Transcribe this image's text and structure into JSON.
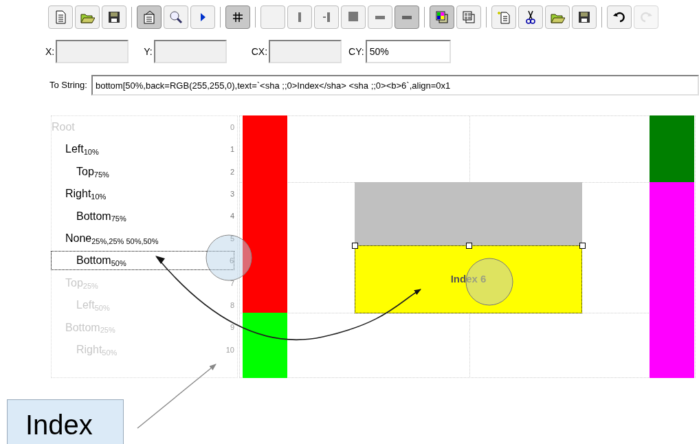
{
  "toolbar": [
    {
      "kind": "new",
      "selected": false,
      "disabled": false
    },
    {
      "kind": "open",
      "selected": false,
      "disabled": false
    },
    {
      "kind": "save",
      "selected": false,
      "disabled": false
    },
    {
      "kind": "sep"
    },
    {
      "kind": "properties",
      "selected": true,
      "disabled": false
    },
    {
      "kind": "zoom",
      "selected": false,
      "disabled": false
    },
    {
      "kind": "play",
      "selected": false,
      "disabled": false
    },
    {
      "kind": "sep"
    },
    {
      "kind": "grid",
      "selected": true,
      "disabled": false
    },
    {
      "kind": "sep"
    },
    {
      "kind": "blank",
      "selected": false,
      "disabled": false
    },
    {
      "kind": "lines1",
      "selected": false,
      "disabled": false
    },
    {
      "kind": "lines2",
      "selected": false,
      "disabled": false
    },
    {
      "kind": "lines3",
      "selected": false,
      "disabled": false
    },
    {
      "kind": "ticktop",
      "selected": false,
      "disabled": false
    },
    {
      "kind": "tickbottom",
      "selected": true,
      "disabled": false
    },
    {
      "kind": "sep"
    },
    {
      "kind": "colors",
      "selected": true,
      "disabled": false
    },
    {
      "kind": "panes",
      "selected": false,
      "disabled": false
    },
    {
      "kind": "sep"
    },
    {
      "kind": "newdoc",
      "selected": false,
      "disabled": false
    },
    {
      "kind": "cut",
      "selected": false,
      "disabled": false
    },
    {
      "kind": "open",
      "selected": false,
      "disabled": false
    },
    {
      "kind": "save",
      "selected": false,
      "disabled": false
    },
    {
      "kind": "sep"
    },
    {
      "kind": "undo",
      "selected": false,
      "disabled": false
    },
    {
      "kind": "redo",
      "selected": false,
      "disabled": true
    }
  ],
  "coords": [
    {
      "label": "X:"
    },
    {
      "label": "Y:"
    },
    {
      "label": "CX:"
    },
    {
      "label": "CY:",
      "value": "50%"
    }
  ],
  "to_string": {
    "label": "To String:",
    "value": "bottom[50%,back=RGB(255,255,0),text=`<sha ;;0>Index</sha> <sha ;;0><b>6`,align=0x1"
  },
  "tree": {
    "items": [
      {
        "label": "Root",
        "index": "0",
        "disabled": true,
        "selected": false,
        "children": [
          {
            "label": "Left",
            "size": "10%",
            "index": "1",
            "disabled": false,
            "selected": false,
            "children": [
              {
                "label": "Top",
                "size": "75%",
                "index": "2",
                "disabled": false,
                "selected": false
              }
            ]
          },
          {
            "label": "Right",
            "size": "10%",
            "index": "3",
            "disabled": false,
            "selected": false,
            "children": [
              {
                "label": "Bottom",
                "size": "75%",
                "index": "4",
                "disabled": false,
                "selected": false
              }
            ]
          },
          {
            "label": "None",
            "size": "25%,25% 50%,50%",
            "index": "5",
            "disabled": false,
            "selected": false,
            "children": [
              {
                "label": "Bottom",
                "size": "50%",
                "index": "6",
                "disabled": false,
                "selected": true
              }
            ]
          },
          {
            "label": "Top",
            "size": "25%",
            "index": "7",
            "disabled": true,
            "selected": false,
            "children": [
              {
                "label": "Left",
                "size": "50%",
                "index": "8",
                "disabled": true,
                "selected": false
              }
            ]
          },
          {
            "label": "Bottom",
            "size": "25%",
            "index": "9",
            "disabled": true,
            "selected": false,
            "children": [
              {
                "label": "Right",
                "size": "50%",
                "index": "10",
                "disabled": true,
                "selected": false
              }
            ]
          }
        ]
      }
    ]
  },
  "canvas": {
    "blocks": [
      {
        "color": "#ff0000",
        "selected": false
      },
      {
        "color": "#00ff00",
        "selected": false
      },
      {
        "color": "#007f00",
        "selected": false
      },
      {
        "color": "#ff00ff",
        "selected": false
      },
      {
        "color": "#c0c0c0",
        "selected": false
      },
      {
        "color": "#ffff00",
        "selected": true,
        "text": "Index 6"
      }
    ]
  },
  "callout": {
    "text": "Index"
  }
}
